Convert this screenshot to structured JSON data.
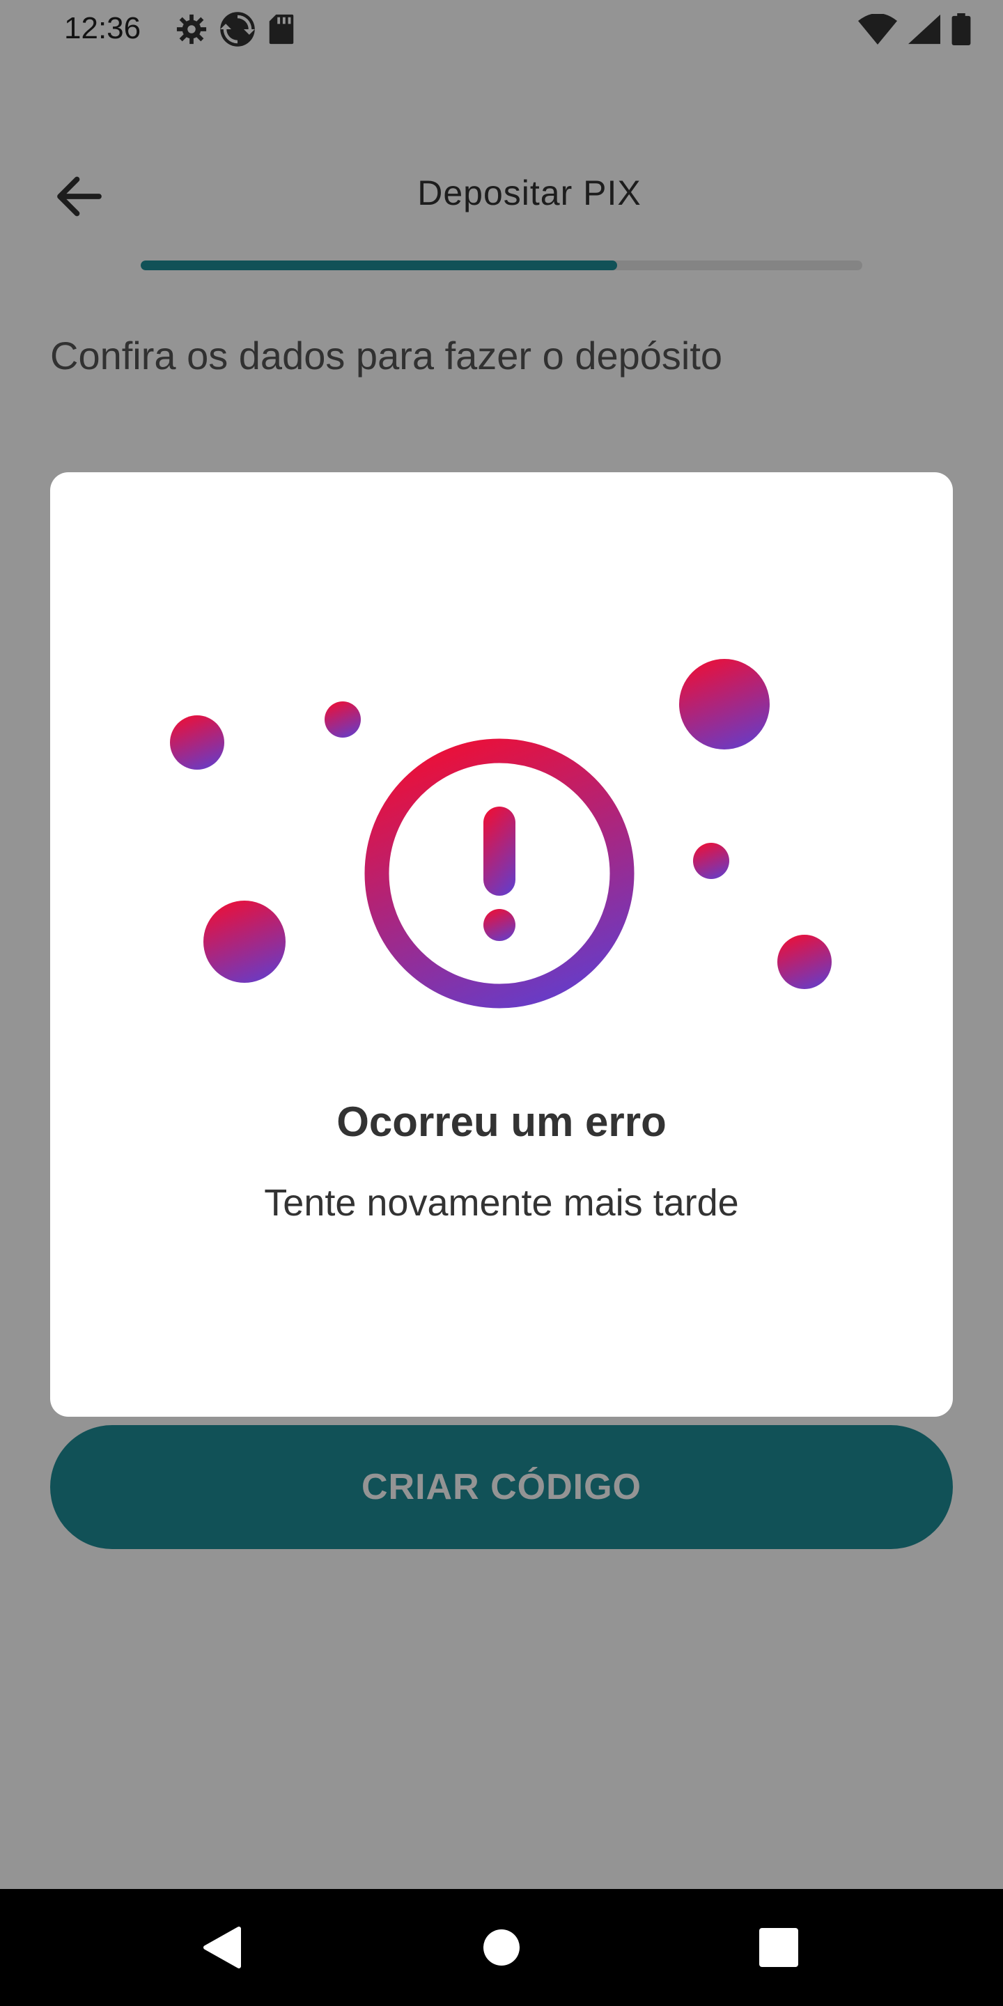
{
  "status_bar": {
    "time": "12:36",
    "left_icons": [
      "gear-icon",
      "sync-icon",
      "sd-card-icon"
    ],
    "right_icons": [
      "wifi-icon",
      "signal-icon",
      "battery-icon"
    ]
  },
  "header": {
    "back_icon": "arrow-left-icon",
    "title": "Depositar PIX",
    "progress": 0.66
  },
  "content": {
    "subtitle": "Confira os dados para fazer o depósito",
    "cta_label": "CRIAR CÓDIGO"
  },
  "dialog": {
    "icon": "error-exclamation-icon",
    "title": "Ocorreu um erro",
    "message": "Tente novamente mais tarde"
  },
  "nav_bar": {
    "icons": [
      "back-triangle-icon",
      "home-circle-icon",
      "recents-square-icon"
    ]
  },
  "colors": {
    "accent": "#1e8c96",
    "error_gradient_start": "#e8113c",
    "error_gradient_end": "#6a3bc4"
  }
}
